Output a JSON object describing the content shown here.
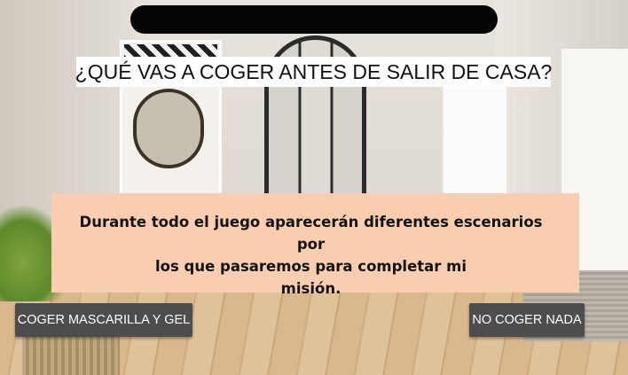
{
  "header": {
    "question": "¿QUÉ VAS A COGER ANTES DE SALIR DE CASA?"
  },
  "info": {
    "lines": [
      "Durante todo el juego aparecerán diferentes escenarios por",
      "los que pasaremos para completar mi",
      "misión."
    ]
  },
  "choices": {
    "left_label": "COGER MASCARILLA Y GEL",
    "right_label": "NO COGER NADA"
  },
  "colors": {
    "top_bar": "#050505",
    "info_box": "#f8cdb0",
    "button": "#4d4d4d"
  }
}
